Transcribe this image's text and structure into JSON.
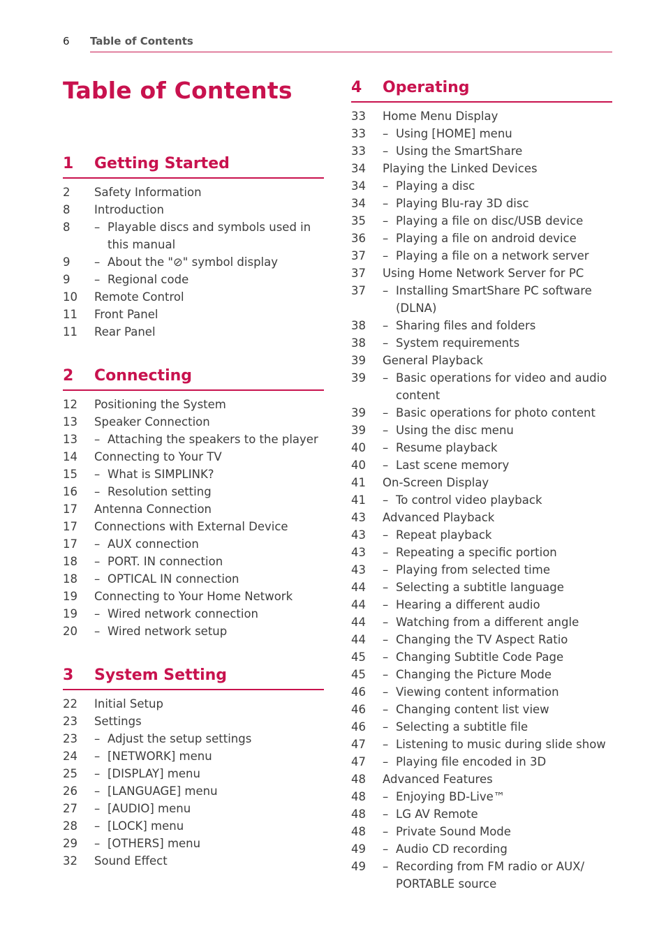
{
  "running_head": {
    "page_number": "6",
    "title": "Table of Contents"
  },
  "page_title": "Table of Contents",
  "accent_color": "#c8124e",
  "sections": [
    {
      "number": "1",
      "title": "Getting Started",
      "entries": [
        {
          "page": "2",
          "text": "Safety Information",
          "sub": false
        },
        {
          "page": "8",
          "text": "Introduction",
          "sub": false
        },
        {
          "page": "8",
          "text": "Playable discs and symbols used in this manual",
          "sub": true
        },
        {
          "page": "9",
          "text": "About the \"⊘\" symbol display",
          "sub": true
        },
        {
          "page": "9",
          "text": "Regional code",
          "sub": true
        },
        {
          "page": "10",
          "text": "Remote Control",
          "sub": false
        },
        {
          "page": "11",
          "text": "Front Panel",
          "sub": false
        },
        {
          "page": "11",
          "text": "Rear Panel",
          "sub": false
        }
      ]
    },
    {
      "number": "2",
      "title": "Connecting",
      "entries": [
        {
          "page": "12",
          "text": "Positioning the System",
          "sub": false
        },
        {
          "page": "13",
          "text": "Speaker Connection",
          "sub": false
        },
        {
          "page": "13",
          "text": "Attaching the speakers to the player",
          "sub": true
        },
        {
          "page": "14",
          "text": "Connecting to Your TV",
          "sub": false
        },
        {
          "page": "15",
          "text": "What is SIMPLINK?",
          "sub": true
        },
        {
          "page": "16",
          "text": "Resolution setting",
          "sub": true
        },
        {
          "page": "17",
          "text": "Antenna Connection",
          "sub": false
        },
        {
          "page": "17",
          "text": "Connections with External Device",
          "sub": false
        },
        {
          "page": "17",
          "text": "AUX connection",
          "sub": true
        },
        {
          "page": "18",
          "text": "PORT. IN connection",
          "sub": true
        },
        {
          "page": "18",
          "text": "OPTICAL IN connection",
          "sub": true
        },
        {
          "page": "19",
          "text": "Connecting to Your Home Network",
          "sub": false
        },
        {
          "page": "19",
          "text": "Wired network connection",
          "sub": true
        },
        {
          "page": "20",
          "text": "Wired network setup",
          "sub": true
        }
      ]
    },
    {
      "number": "3",
      "title": "System Setting",
      "entries": [
        {
          "page": "22",
          "text": "Initial Setup",
          "sub": false
        },
        {
          "page": "23",
          "text": "Settings",
          "sub": false
        },
        {
          "page": "23",
          "text": "Adjust the setup settings",
          "sub": true
        },
        {
          "page": "24",
          "text": "[NETWORK] menu",
          "sub": true
        },
        {
          "page": "25",
          "text": "[DISPLAY] menu",
          "sub": true
        },
        {
          "page": "26",
          "text": "[LANGUAGE] menu",
          "sub": true
        },
        {
          "page": "27",
          "text": "[AUDIO] menu",
          "sub": true
        },
        {
          "page": "28",
          "text": "[LOCK] menu",
          "sub": true
        },
        {
          "page": "29",
          "text": "[OTHERS] menu",
          "sub": true
        },
        {
          "page": "32",
          "text": "Sound Effect",
          "sub": false
        }
      ]
    },
    {
      "number": "4",
      "title": "Operating",
      "entries": [
        {
          "page": "33",
          "text": "Home Menu Display",
          "sub": false
        },
        {
          "page": "33",
          "text": "Using [HOME] menu",
          "sub": true
        },
        {
          "page": "33",
          "text": "Using the SmartShare",
          "sub": true
        },
        {
          "page": "34",
          "text": "Playing the Linked Devices",
          "sub": false
        },
        {
          "page": "34",
          "text": "Playing a disc",
          "sub": true
        },
        {
          "page": "34",
          "text": "Playing Blu-ray 3D disc",
          "sub": true
        },
        {
          "page": "35",
          "text": "Playing a file on disc/USB device",
          "sub": true
        },
        {
          "page": "36",
          "text": "Playing a file on android device",
          "sub": true
        },
        {
          "page": "37",
          "text": "Playing a file on a network server",
          "sub": true
        },
        {
          "page": "37",
          "text": "Using Home Network Server for PC",
          "sub": false
        },
        {
          "page": "37",
          "text": "Installing SmartShare PC software (DLNA)",
          "sub": true
        },
        {
          "page": "38",
          "text": "Sharing files and folders",
          "sub": true
        },
        {
          "page": "38",
          "text": "System requirements",
          "sub": true
        },
        {
          "page": "39",
          "text": "General Playback",
          "sub": false
        },
        {
          "page": "39",
          "text": "Basic operations for video and audio content",
          "sub": true
        },
        {
          "page": "39",
          "text": "Basic operations for photo content",
          "sub": true
        },
        {
          "page": "39",
          "text": "Using the disc menu",
          "sub": true
        },
        {
          "page": "40",
          "text": "Resume playback",
          "sub": true
        },
        {
          "page": "40",
          "text": "Last scene memory",
          "sub": true
        },
        {
          "page": "41",
          "text": "On-Screen Display",
          "sub": false
        },
        {
          "page": "41",
          "text": "To control video playback",
          "sub": true
        },
        {
          "page": "43",
          "text": "Advanced Playback",
          "sub": false
        },
        {
          "page": "43",
          "text": "Repeat playback",
          "sub": true
        },
        {
          "page": "43",
          "text": "Repeating a specific portion",
          "sub": true
        },
        {
          "page": "43",
          "text": "Playing from selected time",
          "sub": true
        },
        {
          "page": "44",
          "text": "Selecting a subtitle language",
          "sub": true
        },
        {
          "page": "44",
          "text": "Hearing a different audio",
          "sub": true
        },
        {
          "page": "44",
          "text": "Watching from a different angle",
          "sub": true
        },
        {
          "page": "44",
          "text": "Changing the TV Aspect Ratio",
          "sub": true
        },
        {
          "page": "45",
          "text": "Changing Subtitle Code Page",
          "sub": true
        },
        {
          "page": "45",
          "text": "Changing the Picture Mode",
          "sub": true
        },
        {
          "page": "46",
          "text": "Viewing content information",
          "sub": true
        },
        {
          "page": "46",
          "text": "Changing content list view",
          "sub": true
        },
        {
          "page": "46",
          "text": "Selecting a subtitle file",
          "sub": true
        },
        {
          "page": "47",
          "text": "Listening to music during slide show",
          "sub": true
        },
        {
          "page": "47",
          "text": "Playing file encoded in 3D",
          "sub": true
        },
        {
          "page": "48",
          "text": "Advanced Features",
          "sub": false
        },
        {
          "page": "48",
          "text": "Enjoying BD-Live™",
          "sub": true
        },
        {
          "page": "48",
          "text": "LG AV Remote",
          "sub": true
        },
        {
          "page": "48",
          "text": "Private Sound Mode",
          "sub": true
        },
        {
          "page": "49",
          "text": "Audio CD recording",
          "sub": true
        },
        {
          "page": "49",
          "text": "Recording from FM radio or AUX/ PORTABLE source",
          "sub": true
        }
      ]
    }
  ]
}
